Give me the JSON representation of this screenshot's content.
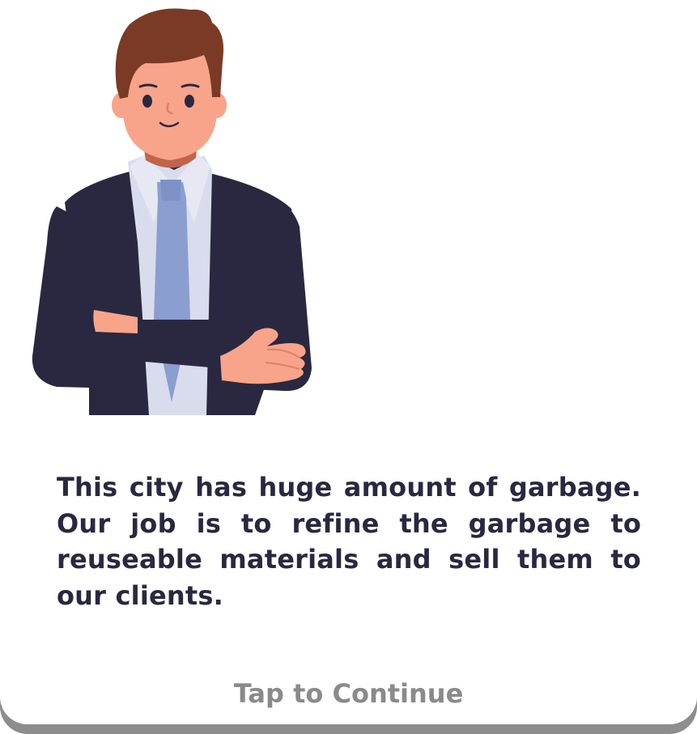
{
  "dialog": {
    "message": "This city has huge amount of garbage. Our job is to refine the garbage to reuseable materials and sell them to our clients.",
    "continue_label": "Tap to Continue"
  },
  "character": {
    "icon": "businessman-character",
    "colors": {
      "hair": "#7a3a25",
      "skin": "#f8a48a",
      "suit": "#2a2840",
      "shirt": "#d9dced",
      "tie": "#8a9ed0"
    }
  },
  "colors": {
    "text": "#2a2840",
    "continue_text": "#8a8a8a",
    "card_shadow": "#8d8d8d",
    "background": "#ffffff"
  }
}
